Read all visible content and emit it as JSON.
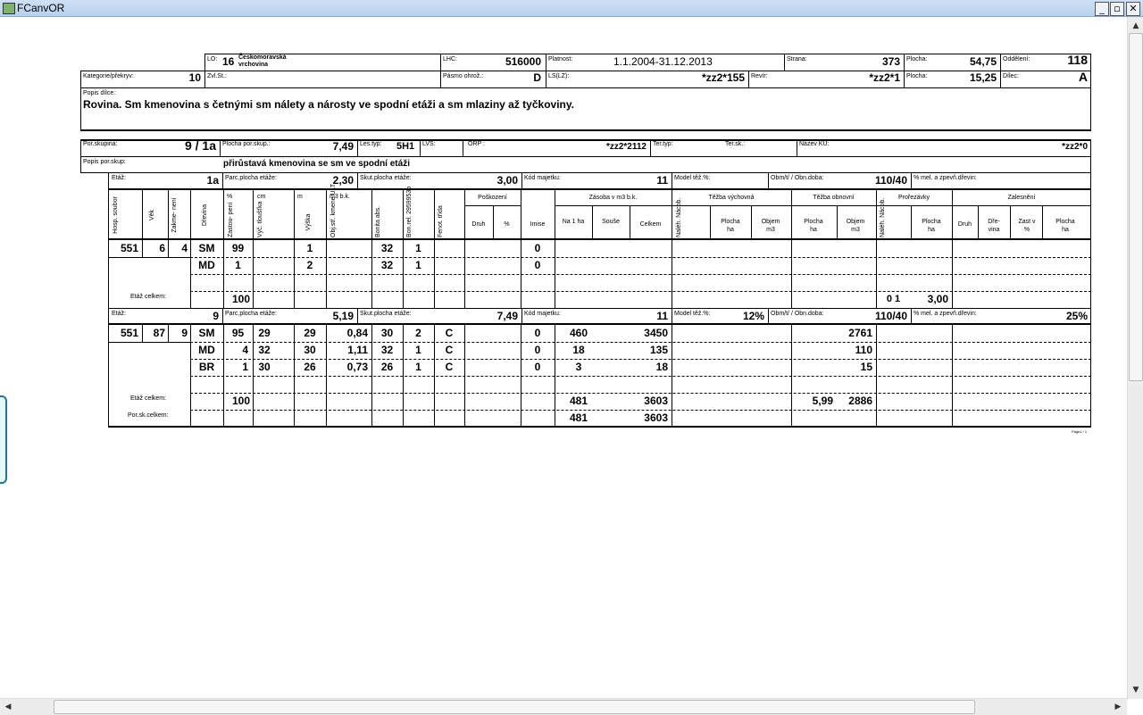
{
  "window": {
    "title": "FCanvOR",
    "minimize": "_",
    "restore": "▫",
    "close": "✕"
  },
  "header": {
    "lo_label": "LO:",
    "lo_num": "16",
    "lo_name": "Českomoravská vrchovina",
    "lhc_label": "LHC:",
    "lhc": "516000",
    "platnost_label": "Platnost:",
    "platnost": "1.1.2004-31.12.2013",
    "strana_label": "Strana:",
    "strana": "373",
    "plocha_label": "Plocha:",
    "plocha1": "54,75",
    "oddeleni_label": "Oddělení:",
    "oddeleni": "118",
    "kategorie_label": "Kategorie/překryv:",
    "kategorie": "10",
    "zvlst_label": "Zvl.St.:",
    "pasmo_label": "Pásmo ohrož.:",
    "pasmo": "D",
    "ls_label": "LS(LZ):",
    "ls": "*zz2*155",
    "revir_label": "Revír:",
    "revir": "*zz2*1",
    "plocha2": "15,25",
    "dilec_label": "Dílec:",
    "dilec": "A",
    "popis_label": "Popis dílce:",
    "popis": "Rovina. Sm kmenovina s četnými sm nálety a nárosty ve spodní etáži a sm mlaziny až tyčkoviny."
  },
  "group": {
    "porsk_label": "Por.skupina:",
    "porsk": "9 / 1a",
    "plocha_label": "Plocha por.skup.:",
    "plocha": "7,49",
    "lestyp_label": "Les.typ:",
    "lestyp": "5H1",
    "lvs_label": "LVS:",
    "orp_label": "ORP :",
    "orp": "*zz2*2112",
    "tertyp_label": "Ter.typ:",
    "tersk_label": "Ter.sk.:",
    "nazevku_label": "Název KÚ:",
    "nazevku": "*zz2*0",
    "popis_label": "Popis por.skup:",
    "popis": "přirůstavá kmenovina se sm ve spodní etáži"
  },
  "etaz1": {
    "etaz_label": "Etáž:",
    "etaz": "1a",
    "parc_label": "Parc.plocha etáže:",
    "parc": "2,30",
    "skut_label": "Skut.plocha etáže:",
    "skut": "3,00",
    "kod_label": "Kód majetku:",
    "kod": "11",
    "model_label": "Model těž.%:",
    "model": "",
    "obmyti_label": "Obm/t/ / Obn.doba:",
    "obmyti": "110/40",
    "mel_label": "% mel. a zpevň.dřevin:",
    "mel": ""
  },
  "etaz2": {
    "etaz_label": "Etáž:",
    "etaz": "9",
    "parc_label": "Parc.plocha etáže:",
    "parc": "5,19",
    "skut_label": "Skut.plocha etáže:",
    "skut": "7,49",
    "kod_label": "Kód majetku:",
    "kod": "11",
    "model_label": "Model těž.%:",
    "model": "12%",
    "obmyti_label": "Obm/t/ / Obn.doba:",
    "obmyti": "110/40",
    "mel_label": "% mel. a zpevň.dřevin:",
    "mel": "25%"
  },
  "columns": {
    "hosp_soubor": "Hosp. soubor",
    "vek": "Věk",
    "zakmeneni": "Zakme- není",
    "drevina": "Dřevina",
    "zastoupeni": "Zastou- pení",
    "pct": "%",
    "cm": "cm",
    "vyc_tloustka": "Výč. tloušťka",
    "m": "m",
    "vyska": "Výška",
    "m3bk": "m3 b.k.",
    "objstr": "Obj.stř. kmene ULT",
    "bonita_abs": "Bonita abs.",
    "bonita_rel": "Bon.rel. 2959953b",
    "fenotyp": "Fenot. třída",
    "poskozeni": "Poškození",
    "druh": "Druh",
    "pct2": "%",
    "imise": "Imise",
    "zasoba": "Zásoba v m3 b.k.",
    "na1ha": "Na 1 ha",
    "souse": "Souše",
    "celkem": "Celkem",
    "tezba_vych": "Těžba výchovná",
    "nalehavost": "Naléh. Nácob.",
    "plocha_ha": "Plocha ha",
    "objem_m3": "Objem m3",
    "tezba_obn": "Těžba obnovní",
    "plocha_ha2": "Plocha ha",
    "objem_m32": "Objem m3",
    "prorezavky": "Prořezávky",
    "nalehavost2": "Naléh. Nácob.",
    "plocha_ha3": "Plocha ha",
    "zalesneni": "Zalesnění",
    "druh2": "Druh",
    "drevina2": "Dře- vina",
    "zast": "Zast v %",
    "plocha_ha4": "Plocha ha"
  },
  "block1": {
    "hosp": "551",
    "vek": "6",
    "zakm": "4",
    "rows": [
      {
        "dr": "SM",
        "zast": "99",
        "vysk": "1",
        "bon": "32",
        "bonr": "1",
        "imise": "0"
      },
      {
        "dr": "MD",
        "zast": "1",
        "vysk": "2",
        "bon": "32",
        "bonr": "1",
        "imise": "0"
      }
    ],
    "total_label": "Etáž celkem:",
    "total_zast": "100",
    "pror_nal": "0 1",
    "pror_plocha": "3,00"
  },
  "block2": {
    "hosp": "551",
    "vek": "87",
    "zakm": "9",
    "rows": [
      {
        "dr": "SM",
        "zast": "95",
        "cm": "29",
        "vysk": "29",
        "obj": "0,84",
        "bon": "30",
        "bonr": "2",
        "fen": "C",
        "imise": "0",
        "na1": "460",
        "cel": "3450",
        "obn_obj": "2761"
      },
      {
        "dr": "MD",
        "zast": "4",
        "cm": "32",
        "vysk": "30",
        "obj": "1,11",
        "bon": "32",
        "bonr": "1",
        "fen": "C",
        "imise": "0",
        "na1": "18",
        "cel": "135",
        "obn_obj": "110"
      },
      {
        "dr": "BR",
        "zast": "1",
        "cm": "30",
        "vysk": "26",
        "obj": "0,73",
        "bon": "26",
        "bonr": "1",
        "fen": "C",
        "imise": "0",
        "na1": "3",
        "cel": "18",
        "obn_obj": "15"
      }
    ],
    "total_label": "Etáž celkem:",
    "total_zast": "100",
    "total_na1": "481",
    "total_cel": "3603",
    "total_obn_plocha": "5,99",
    "total_obn_obj": "2886",
    "porsk_label": "Por.sk.celkem:",
    "porsk_na1": "481",
    "porsk_cel": "3603"
  },
  "footer_tag": "Page1 / 1"
}
